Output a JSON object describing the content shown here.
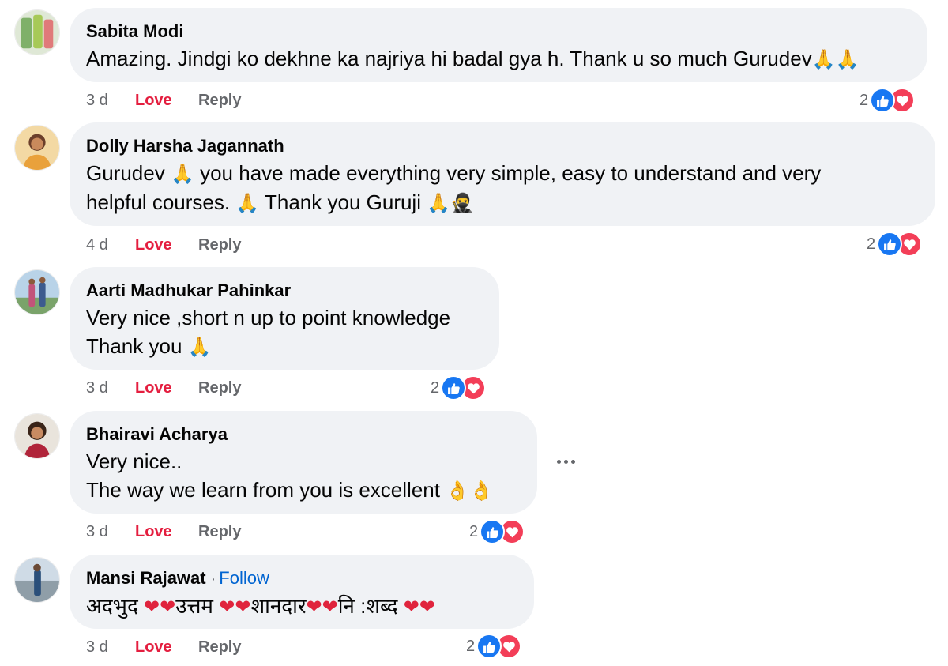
{
  "comments": [
    {
      "author": "Sabita Modi",
      "text": "Amazing. Jindgi ko dekhne ka najriya hi badal gya h. Thank u so much Gurudev",
      "time": "3 d",
      "love_label": "Love",
      "reply_label": "Reply",
      "reaction_count": "2"
    },
    {
      "author": "Dolly Harsha Jagannath",
      "line1_a": "Gurudev",
      "line1_b": "you have made everything very simple, easy to understand and very",
      "line2_a": "helpful courses.",
      "line2_b": "Thank you Guruji",
      "time": "4 d",
      "love_label": "Love",
      "reply_label": "Reply",
      "reaction_count": "2"
    },
    {
      "author": "Aarti Madhukar Pahinkar",
      "line1": "Very nice ,short n up to point knowledge",
      "line2": "Thank you",
      "time": "3 d",
      "love_label": "Love",
      "reply_label": "Reply",
      "reaction_count": "2"
    },
    {
      "author": "Bhairavi Acharya",
      "line1": "Very nice..",
      "line2": "The way we learn from you is excellent",
      "time": "3 d",
      "love_label": "Love",
      "reply_label": "Reply",
      "reaction_count": "2"
    },
    {
      "author": "Mansi Rajawat",
      "follow_label": "Follow",
      "follow_separator": "·",
      "word1": "अदभुद",
      "word2": "उत्तम",
      "word3": "शानदार",
      "word4": "नि :शब्द",
      "time": "3 d",
      "love_label": "Love",
      "reply_label": "Reply",
      "reaction_count": "2"
    }
  ],
  "icons": {
    "pray": "🙏",
    "heart": "❤",
    "ok_hand": "👌",
    "ninja": "🥷",
    "like_reaction": "thumbs-up-icon",
    "love_reaction": "heart-icon",
    "more": "ellipsis-icon"
  },
  "colors": {
    "bubble": "#f0f2f5",
    "love_text": "#e41e3f",
    "like_blue": "#1877f2",
    "love_red": "#f33e58",
    "follow_blue": "#0064d1",
    "meta_gray": "#65676b"
  }
}
